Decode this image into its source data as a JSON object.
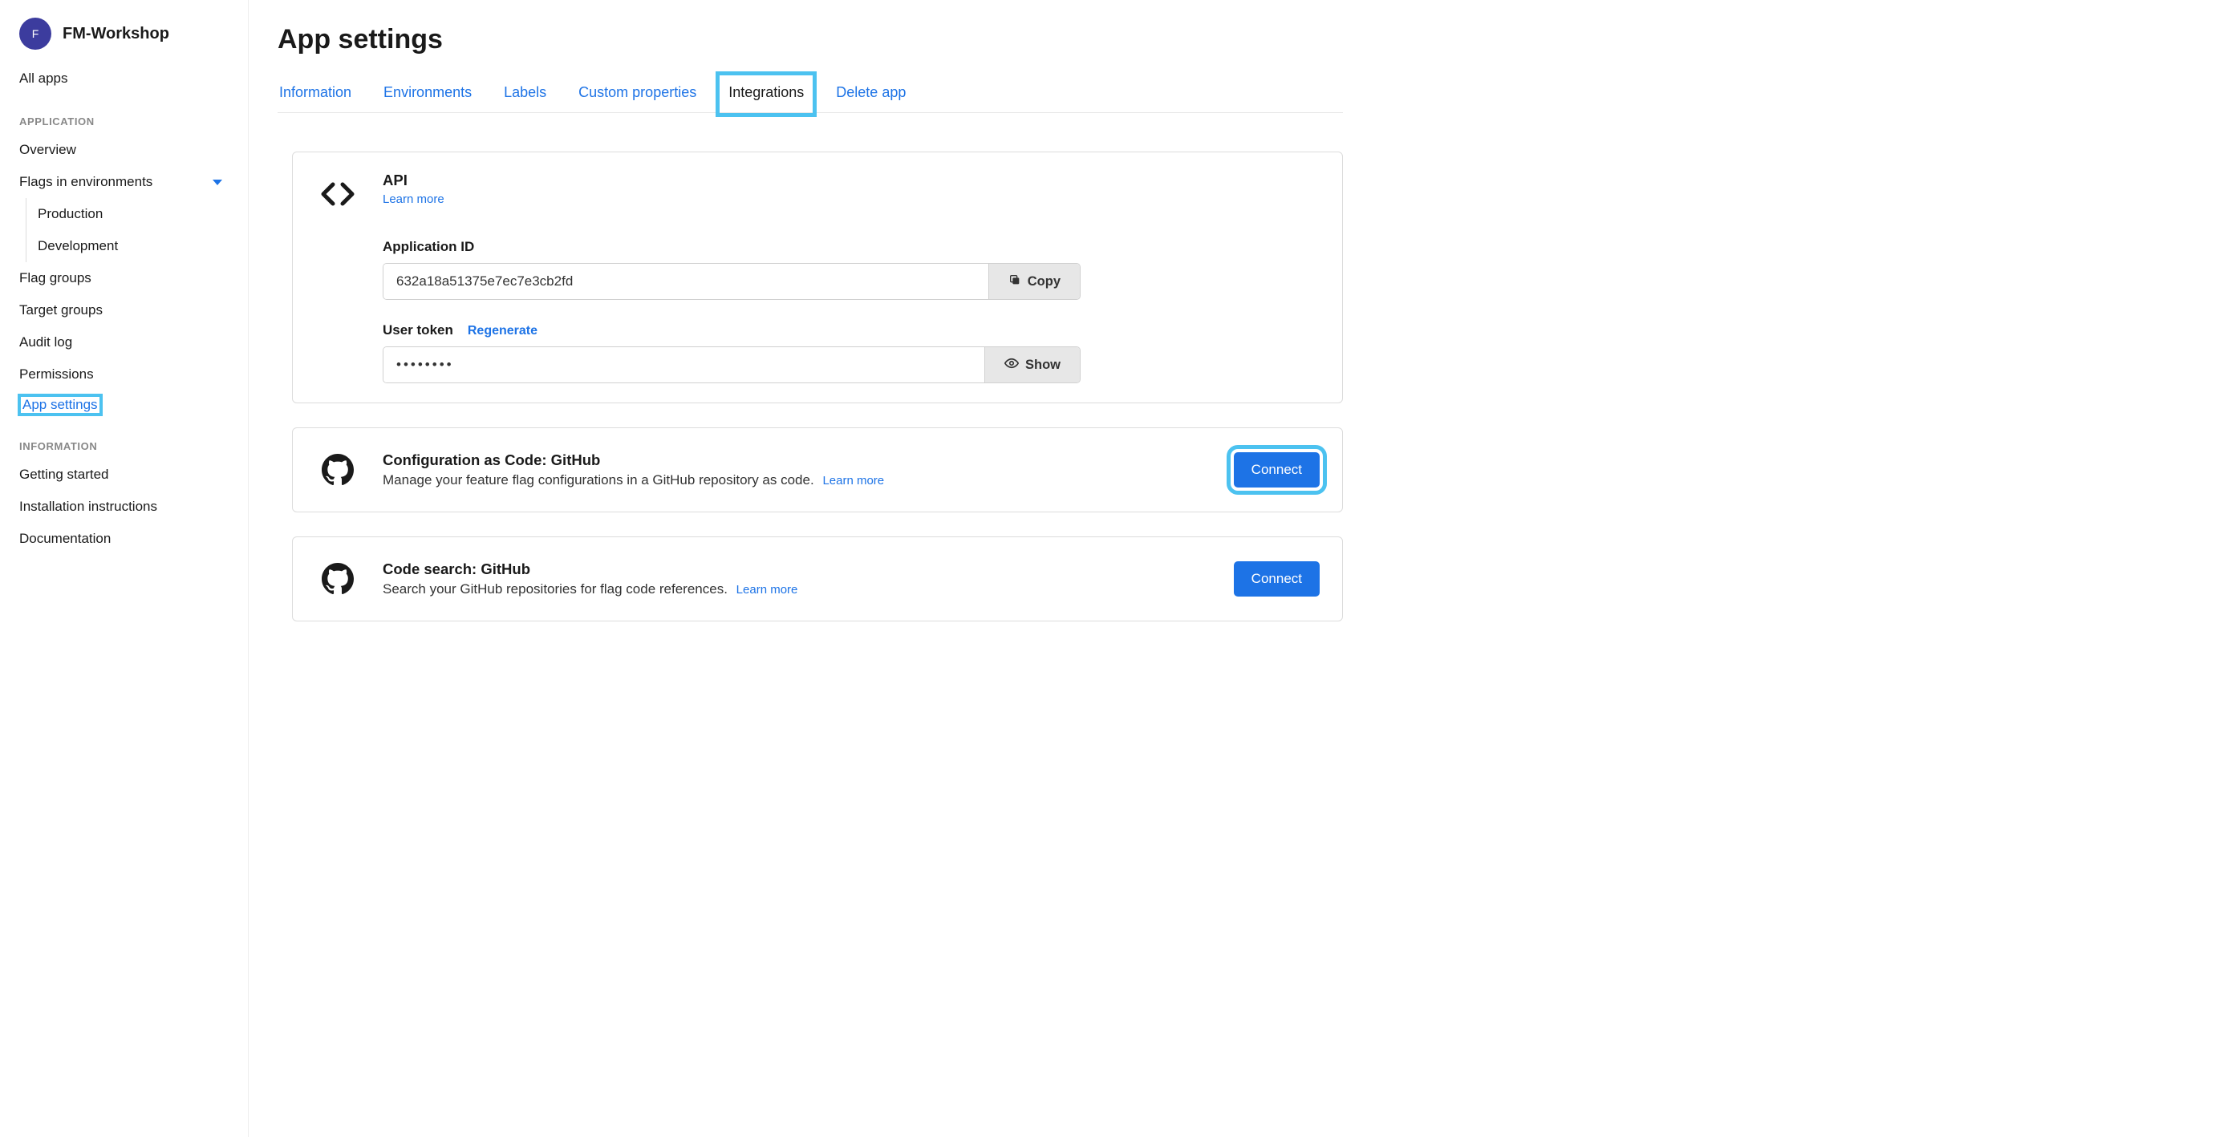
{
  "sidebar": {
    "avatar_letter": "F",
    "workspace_name": "FM-Workshop",
    "all_apps": "All apps",
    "section_application": "APPLICATION",
    "overview": "Overview",
    "flags_in_envs": "Flags in environments",
    "env_production": "Production",
    "env_development": "Development",
    "flag_groups": "Flag groups",
    "target_groups": "Target groups",
    "audit_log": "Audit log",
    "permissions": "Permissions",
    "app_settings": "App settings",
    "section_information": "INFORMATION",
    "getting_started": "Getting started",
    "installation": "Installation instructions",
    "documentation": "Documentation"
  },
  "main": {
    "title": "App settings",
    "tabs": {
      "information": "Information",
      "environments": "Environments",
      "labels": "Labels",
      "custom_properties": "Custom properties",
      "integrations": "Integrations",
      "delete_app": "Delete app"
    },
    "api_card": {
      "title": "API",
      "learn_more": "Learn more",
      "app_id_label": "Application ID",
      "app_id_value": "632a18a51375e7ec7e3cb2fd",
      "copy": "Copy",
      "user_token_label": "User token",
      "regenerate": "Regenerate",
      "user_token_masked": "••••••••",
      "show": "Show"
    },
    "github_config_card": {
      "title": "Configuration as Code: GitHub",
      "desc": "Manage your feature flag configurations in a GitHub repository as code.",
      "learn_more": "Learn more",
      "connect": "Connect"
    },
    "github_search_card": {
      "title": "Code search: GitHub",
      "desc": "Search your GitHub repositories for flag code references.",
      "learn_more": "Learn more",
      "connect": "Connect"
    }
  }
}
